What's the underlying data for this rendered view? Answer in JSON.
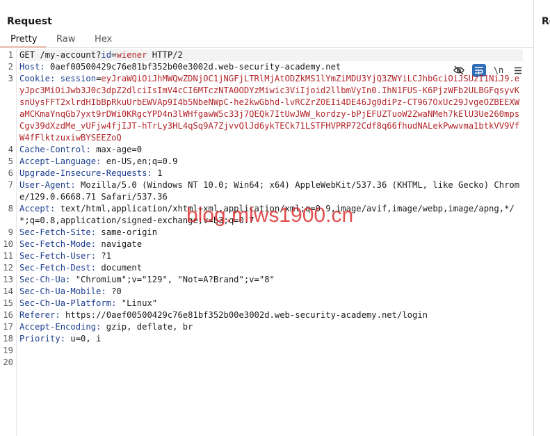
{
  "panel": {
    "title": "Request"
  },
  "tabs": [
    {
      "label": "Pretty",
      "active": true
    },
    {
      "label": "Raw",
      "active": false
    },
    {
      "label": "Hex",
      "active": false
    }
  ],
  "toolbar": {
    "icons": [
      "eye-off-icon",
      "wrap-lines-icon",
      "newline-toggle-icon",
      "menu-icon"
    ],
    "newline_label": "\\n"
  },
  "request": {
    "line1": {
      "num": "1",
      "method": "GET",
      "path_start": " /my-account?",
      "param_name": "id",
      "eq": "=",
      "param_value": "wiener",
      "version": " HTTP/2"
    },
    "line2": {
      "num": "2",
      "name": "Host:",
      "value": " 0aef00500429c76e81bf352b00e3002d.web-security-academy.net"
    },
    "line3": {
      "num": "3",
      "name": "Cookie:",
      "cookie_name": " session",
      "eq": "=",
      "cookie_value": "eyJraWQiOiJhMWQwZDNjOC1jNGFjLTRlMjAtODZkMS1lYmZiMDU3YjQ3ZWYiLCJhbGciOiJSUzI1NiJ9.eyJpc3MiOiJwb3J0c3dpZ2dlciIsImV4cCI6MTczNTA0ODYzMiwic3ViIjoid2llbmVyIn0.IhN1FUS-K6PjzWFb2ULBGFqsyvKsnUysFFT2xlrdHIbBpRkuUrbEWVAp9I4b5NbeNWpC-he2kwGbhd-lvRCZrZ0EIi4DE46Jg0diPz-CT967OxUc29JvgeOZBEEXWaMCKmaYnqGb7yxt9rDWi0KRgcYPD4n3lWHfgawW5c33j7QEQk7ItUwJWW_kordzy-bPjEFUZTuoW2ZwaNMeh7kElU3Ue260mpsCgv39dXzdMe_vUFjw4fjIJT-hTrLy3HL4qSq9A7ZjvvQlJd6ykTECk71LSTFHVPRP72Cdf8q66fhudNALekPwwvma1btkVV9VfW4fFlktzuxiwBYSEEZoQ"
    },
    "line4": {
      "num": "4",
      "name": "Cache-Control:",
      "value": " max-age=0"
    },
    "line5": {
      "num": "5",
      "name": "Accept-Language:",
      "value": " en-US,en;q=0.9"
    },
    "line6": {
      "num": "6",
      "name": "Upgrade-Insecure-Requests:",
      "value": " 1"
    },
    "line7": {
      "num": "7",
      "name": "User-Agent:",
      "value": " Mozilla/5.0 (Windows NT 10.0; Win64; x64) AppleWebKit/537.36 (KHTML, like Gecko) Chrome/129.0.6668.71 Safari/537.36"
    },
    "line8": {
      "num": "8",
      "name": "Accept:",
      "value": " text/html,application/xhtml+xml,application/xml;q=0.9,image/avif,image/webp,image/apng,*/*;q=0.8,application/signed-exchange;v=b3;q=0.7"
    },
    "line9": {
      "num": "9",
      "name": "Sec-Fetch-Site:",
      "value": " same-origin"
    },
    "line10": {
      "num": "10",
      "name": "Sec-Fetch-Mode:",
      "value": " navigate"
    },
    "line11": {
      "num": "11",
      "name": "Sec-Fetch-User:",
      "value": " ?1"
    },
    "line12": {
      "num": "12",
      "name": "Sec-Fetch-Dest:",
      "value": " document"
    },
    "line13": {
      "num": "13",
      "name": "Sec-Ch-Ua:",
      "value": " \"Chromium\";v=\"129\", \"Not=A?Brand\";v=\"8\""
    },
    "line14": {
      "num": "14",
      "name": "Sec-Ch-Ua-Mobile:",
      "value": " ?0"
    },
    "line15": {
      "num": "15",
      "name": "Sec-Ch-Ua-Platform:",
      "value": " \"Linux\""
    },
    "line16": {
      "num": "16",
      "name": "Referer:",
      "value": " https://0aef00500429c76e81bf352b00e3002d.web-security-academy.net/login"
    },
    "line17": {
      "num": "17",
      "name": "Accept-Encoding:",
      "value": " gzip, deflate, br"
    },
    "line18": {
      "num": "18",
      "name": "Priority:",
      "value": " u=0, i"
    },
    "line19": {
      "num": "19"
    },
    "line20": {
      "num": "20"
    }
  },
  "right_panel": {
    "title": "Response"
  },
  "watermark": {
    "text": "blog.mlws1900.cn"
  },
  "colors": {
    "accent": "#e8602c",
    "header_name": "#1b3d8f",
    "value_red": "#b3262b",
    "wrap_icon_bg": "#2f6db5"
  }
}
